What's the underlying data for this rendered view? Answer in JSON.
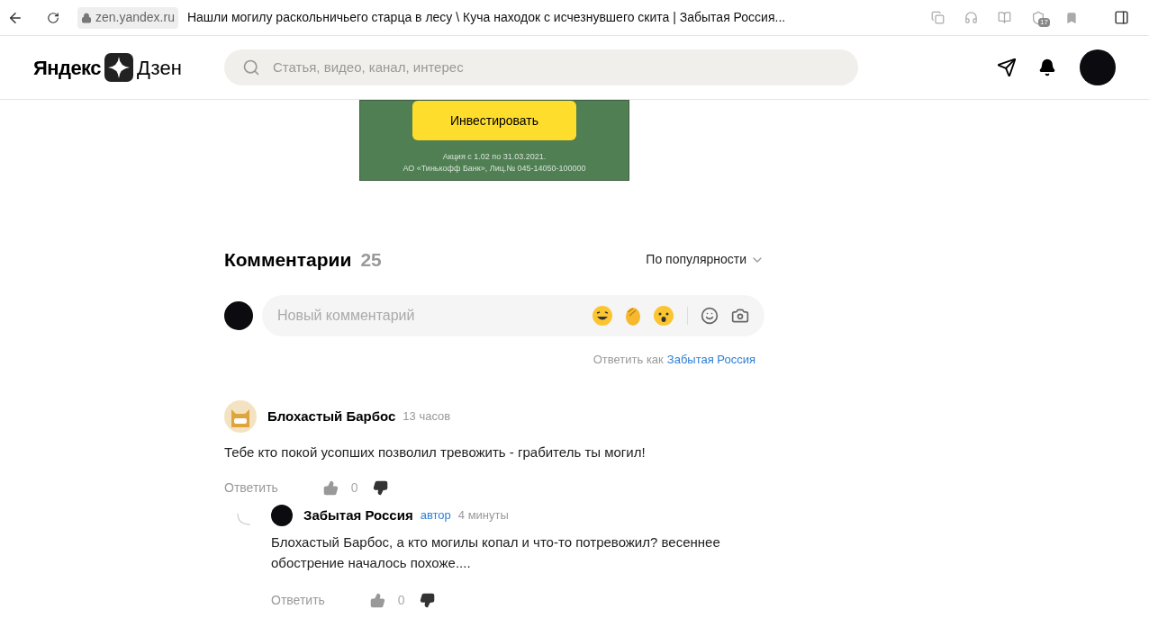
{
  "browser": {
    "address": "zen.yandex.ru",
    "title": "Нашли могилу раскольничьего старца в лесу \\ Куча находок с исчезнувшего скита | Забытая Россия...",
    "extension_badge": "17"
  },
  "header": {
    "logo_left": "Яндекс",
    "logo_right": "Дзен",
    "search": {
      "placeholder": "Статья, видео, канал, интерес"
    }
  },
  "ad": {
    "button": "Инвестировать",
    "legal": [
      "Акция с 1.02 по 31.03.2021.",
      "АО «Тинькофф Банк», Лиц.№ 045-14050-100000"
    ]
  },
  "comments": {
    "title": "Комментарии",
    "count": "25",
    "sort": "По популярности",
    "input": {
      "placeholder": "Новый комментарий"
    },
    "reply_as": {
      "label": "Ответить как",
      "name": "Забытая Россия"
    },
    "items": [
      {
        "author": "Блохастый Барбос",
        "time": "13 часов",
        "avatar": {
          "kind": "cat"
        },
        "text": "Тебе кто покой усопших позволил тревожить - грабитель ты могил!",
        "reply": "Ответить",
        "likes": "0",
        "children": [
          {
            "author": "Забытая Россия",
            "badge": "автор",
            "time": "4 минуты",
            "avatar": {
              "kind": "dark"
            },
            "text": "Блохастый Барбос, а кто могилы копал и что-то потревожил? весеннее обострение началось похоже....",
            "reply": "Ответить",
            "likes": "0"
          }
        ]
      }
    ]
  }
}
